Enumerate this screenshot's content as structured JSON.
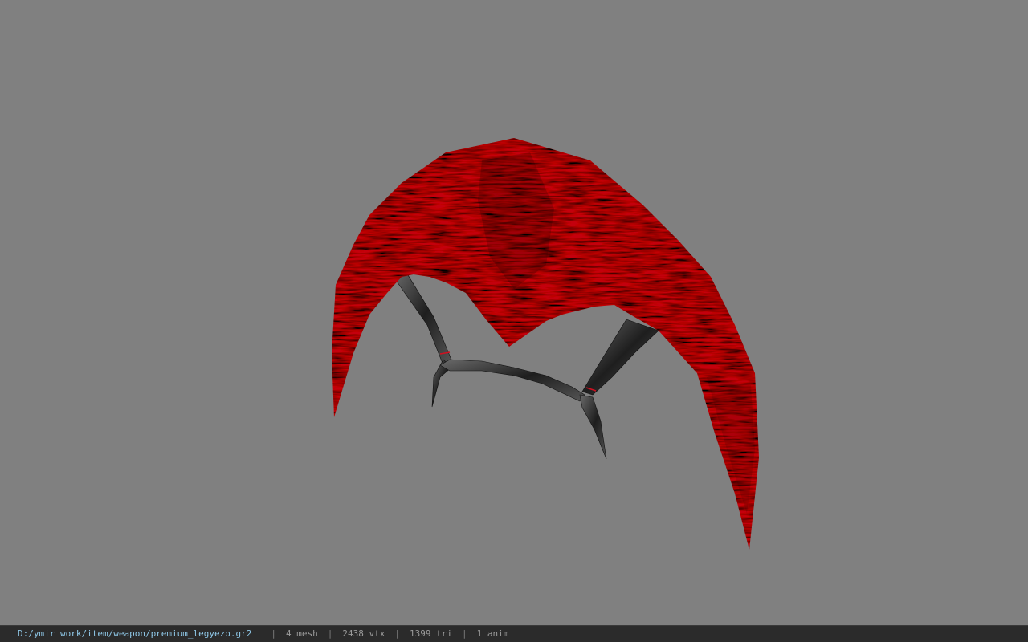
{
  "viewer": {
    "background_color": "#808080",
    "model": {
      "description_icon": "bow-model",
      "limb_color": "#c00000",
      "string_color": "#3a3a3a"
    }
  },
  "status_bar": {
    "file_path": "D:/ymir work/item/weapon/premium_legyezo.gr2",
    "separator": "|",
    "mesh_count": "4 mesh",
    "vertex_count": "2438 vtx",
    "triangle_count": "1399 tri",
    "anim_count": "1 anim"
  }
}
